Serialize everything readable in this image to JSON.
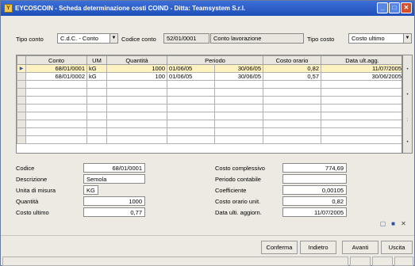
{
  "window": {
    "title": "EYCOSCOIN - Scheda determinazione costi COIND - Ditta: Teamsystem S.r.l."
  },
  "header": {
    "tipo_conto_label": "Tipo conto",
    "tipo_conto_value": "C.d.C. - Conto",
    "codice_conto_label": "Codice conto",
    "codice_conto_value": "52/01/0001",
    "conto_descr": "Conto lavorazione",
    "tipo_costo_label": "Tipo costo",
    "tipo_costo_value": "Costo ultimo"
  },
  "grid": {
    "columns": [
      "Conto",
      "UM",
      "Quantità",
      "Periodo",
      "Costo orario",
      "Data ult.agg."
    ],
    "rows": [
      {
        "conto": "68/01/0001",
        "um": "kG",
        "qta": "1000",
        "dal": "01/06/05",
        "al": "30/06/05",
        "costo": "0,82",
        "data": "11/07/2005"
      },
      {
        "conto": "68/01/0002",
        "um": "kG",
        "qta": "100",
        "dal": "01/06/05",
        "al": "30/06/05",
        "costo": "0,57",
        "data": "30/06/2005"
      }
    ]
  },
  "detail": {
    "codice_label": "Codice",
    "codice": "68/01/0001",
    "descrizione_label": "Descrizione",
    "descrizione": "Semola",
    "um_label": "Unita di misura",
    "um": "KG",
    "quantita_label": "Quantità",
    "quantita": "1000",
    "costo_ultimo_label": "Costo ultimo",
    "costo_ultimo": "0,77",
    "costo_compl_label": "Costo complessivo",
    "costo_compl": "774,69",
    "periodo_label": "Periodo contabile",
    "periodo": "",
    "coeff_label": "Coefficiente",
    "coeff": "0,00105",
    "costo_unit_label": "Costo orario unit.",
    "costo_unit": "0,82",
    "data_label": "Data ulti. aggiorn.",
    "data": "11/07/2005"
  },
  "buttons": {
    "conferma": "Conferma",
    "indietro": "Indietro",
    "avanti": "Avanti",
    "uscita": "Uscita"
  },
  "icons": [
    "new-icon",
    "save-icon",
    "delete-icon"
  ]
}
